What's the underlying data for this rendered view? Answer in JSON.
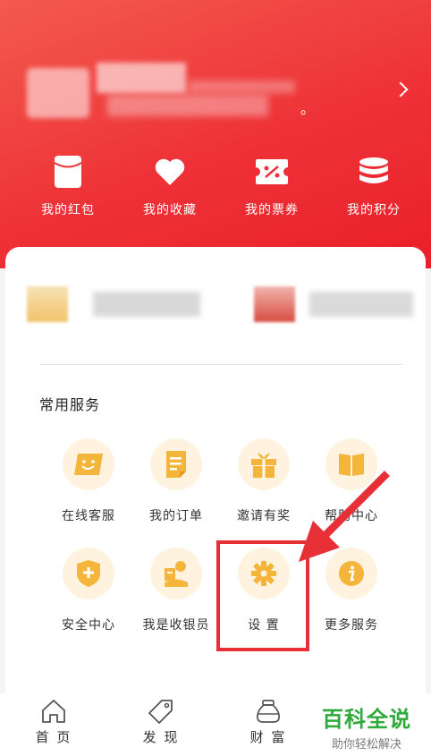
{
  "header": {
    "profile_suffix": "。"
  },
  "quick_actions": [
    {
      "label": "我的红包",
      "icon": "red-packet-icon"
    },
    {
      "label": "我的收藏",
      "icon": "heart-icon"
    },
    {
      "label": "我的票券",
      "icon": "coupon-icon"
    },
    {
      "label": "我的积分",
      "icon": "points-coins-icon"
    }
  ],
  "services": {
    "title": "常用服务",
    "items": [
      {
        "label": "在线客服",
        "icon": "customer-service-icon"
      },
      {
        "label": "我的订单",
        "icon": "order-document-icon"
      },
      {
        "label": "邀请有奖",
        "icon": "gift-icon"
      },
      {
        "label": "帮助中心",
        "icon": "help-book-icon"
      },
      {
        "label": "安全中心",
        "icon": "shield-plus-icon"
      },
      {
        "label": "我是收银员",
        "icon": "cashier-person-icon"
      },
      {
        "label": "设 置",
        "icon": "gear-icon"
      },
      {
        "label": "更多服务",
        "icon": "info-icon"
      }
    ]
  },
  "tabbar": [
    {
      "label": "首 页",
      "icon": "home-icon"
    },
    {
      "label": "发 现",
      "icon": "tag-icon"
    },
    {
      "label": "财 富",
      "icon": "money-bag-icon"
    }
  ],
  "watermark": {
    "title": "百科全说",
    "subtitle": "助你轻松解决"
  },
  "colors": {
    "brand_red": "#ee3237",
    "service_icon": "#f5b53a",
    "service_bg": "#fff3e0",
    "annotation": "#e63035",
    "watermark_green": "#2eaa3a"
  }
}
